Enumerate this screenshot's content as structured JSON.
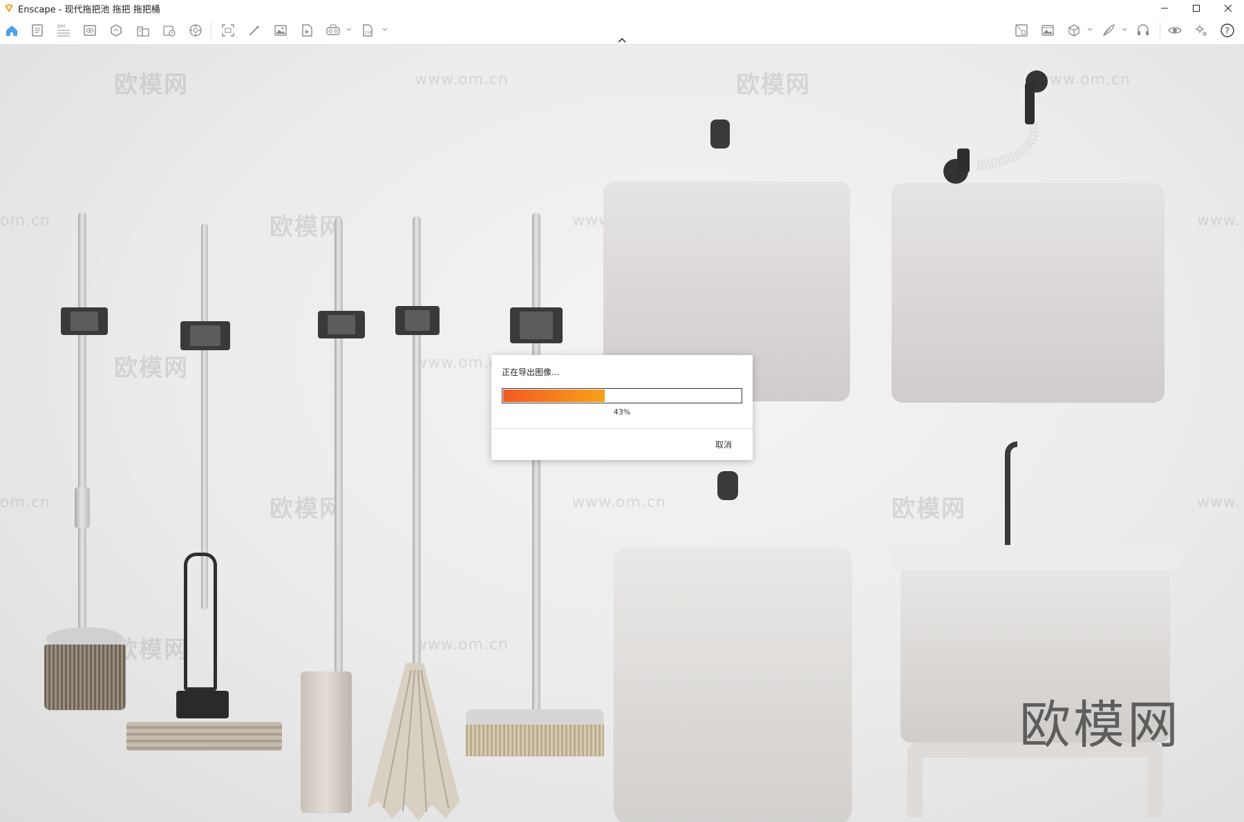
{
  "window": {
    "title": "Enscape - 现代拖把池 拖把 拖把桶",
    "controls": [
      "minimize",
      "maximize",
      "close"
    ]
  },
  "toolbar": {
    "left_icons": [
      "home-icon",
      "assets-icon",
      "bim-icon",
      "views-icon",
      "orbit-icon",
      "building-icon",
      "batch-render-icon",
      "panorama-icon",
      "screenshot-icon",
      "magic-wand-icon",
      "image-export-icon",
      "video-icon",
      "vr-icon",
      "file-export-icon"
    ],
    "right_icons": [
      "material-editor-icon",
      "image-compare-icon",
      "cube-icon",
      "feather-icon",
      "headset-icon",
      "eye-icon",
      "settings-icon",
      "help-icon"
    ]
  },
  "viewport": {
    "watermark_text": "欧模网",
    "watermark_url": "www.om.cn",
    "watermark_fragment": "om.cn",
    "watermark_fragment_right": "www.",
    "brand_mark": "欧模网"
  },
  "export_dialog": {
    "title": "正在导出图像...",
    "progress": 0.43,
    "percent_label": "43%",
    "cancel_label": "取消",
    "colors": {
      "fill_start": "#f25a22",
      "fill_end": "#f7a21b"
    }
  }
}
